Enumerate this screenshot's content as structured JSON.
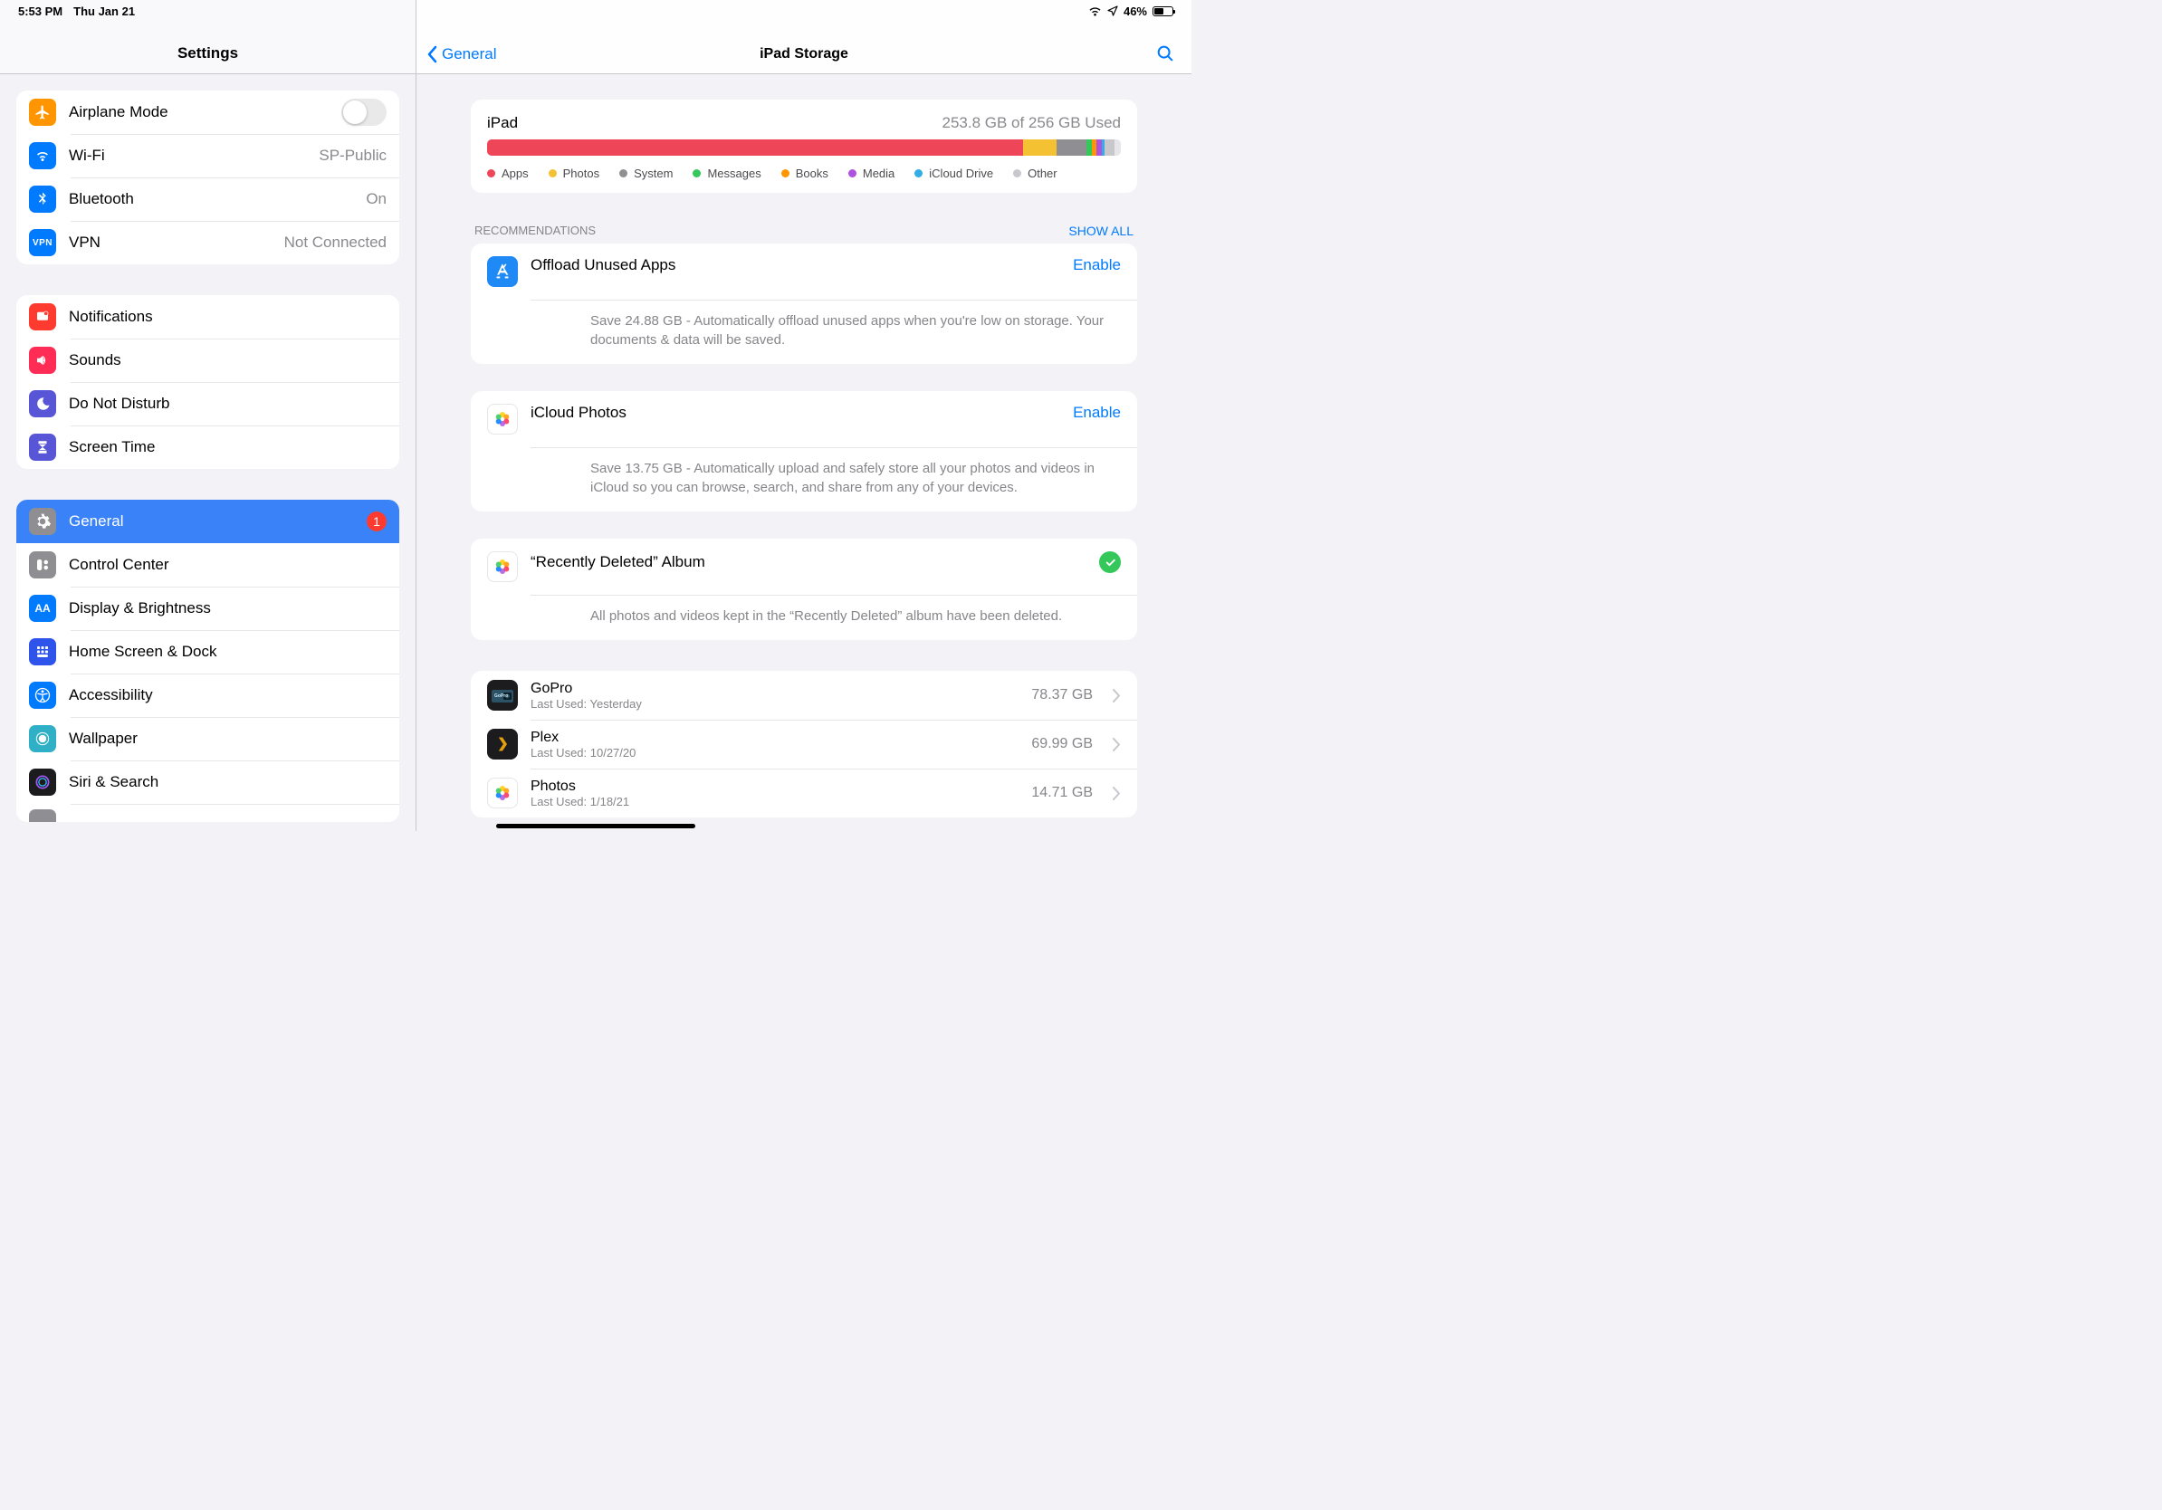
{
  "status": {
    "time": "5:53 PM",
    "date": "Thu Jan 21",
    "battery": "46%"
  },
  "sidebar": {
    "title": "Settings",
    "g1": {
      "airplane": "Airplane Mode",
      "wifi": "Wi-Fi",
      "wifi_val": "SP-Public",
      "bt": "Bluetooth",
      "bt_val": "On",
      "vpn": "VPN",
      "vpn_val": "Not Connected"
    },
    "g2": {
      "notif": "Notifications",
      "sounds": "Sounds",
      "dnd": "Do Not Disturb",
      "st": "Screen Time"
    },
    "g3": {
      "general": "General",
      "general_badge": "1",
      "cc": "Control Center",
      "db": "Display & Brightness",
      "hsd": "Home Screen & Dock",
      "acc": "Accessibility",
      "wp": "Wallpaper",
      "ss": "Siri & Search"
    }
  },
  "detail": {
    "back": "General",
    "title": "iPad Storage",
    "storage": {
      "device": "iPad",
      "used": "253.8 GB of 256 GB Used",
      "legend": {
        "apps": "Apps",
        "photos": "Photos",
        "system": "System",
        "messages": "Messages",
        "books": "Books",
        "media": "Media",
        "icloud": "iCloud Drive",
        "other": "Other"
      }
    },
    "recs_header": "Recommendations",
    "show_all": "SHOW ALL",
    "rec1": {
      "title": "Offload Unused Apps",
      "action": "Enable",
      "desc": "Save 24.88 GB - Automatically offload unused apps when you're low on storage. Your documents & data will be saved."
    },
    "rec2": {
      "title": "iCloud Photos",
      "action": "Enable",
      "desc": "Save 13.75 GB - Automatically upload and safely store all your photos and videos in iCloud so you can browse, search, and share from any of your devices."
    },
    "rec3": {
      "title": "“Recently Deleted” Album",
      "desc": "All photos and videos kept in the “Recently Deleted” album have been deleted."
    },
    "apps": {
      "a1": {
        "name": "GoPro",
        "sub": "Last Used: Yesterday",
        "size": "78.37 GB"
      },
      "a2": {
        "name": "Plex",
        "sub": "Last Used: 10/27/20",
        "size": "69.99 GB"
      },
      "a3": {
        "name": "Photos",
        "sub": "Last Used: 1/18/21",
        "size": "14.71 GB"
      }
    }
  },
  "colors": {
    "apps": "#ef4558",
    "photos": "#f4c132",
    "system": "#8e8e93",
    "messages": "#34c759",
    "books": "#ff9500",
    "media": "#af52de",
    "icloud": "#32ade6",
    "other": "#c7c7cc",
    "airplane": "#ff9500",
    "wifi": "#007aff",
    "bt": "#007aff",
    "vpn": "#007aff",
    "notif": "#ff3b30",
    "sounds": "#ff2d55",
    "dnd": "#5856d6",
    "st": "#5856d6",
    "general_sel": "#8e8e93",
    "cc": "#8e8e93",
    "db": "#007aff",
    "hsd": "#2f54eb",
    "acc": "#007aff",
    "wp": "#30b0c7",
    "ss": "#2c2c2e",
    "appstore": "#1f8af5"
  }
}
